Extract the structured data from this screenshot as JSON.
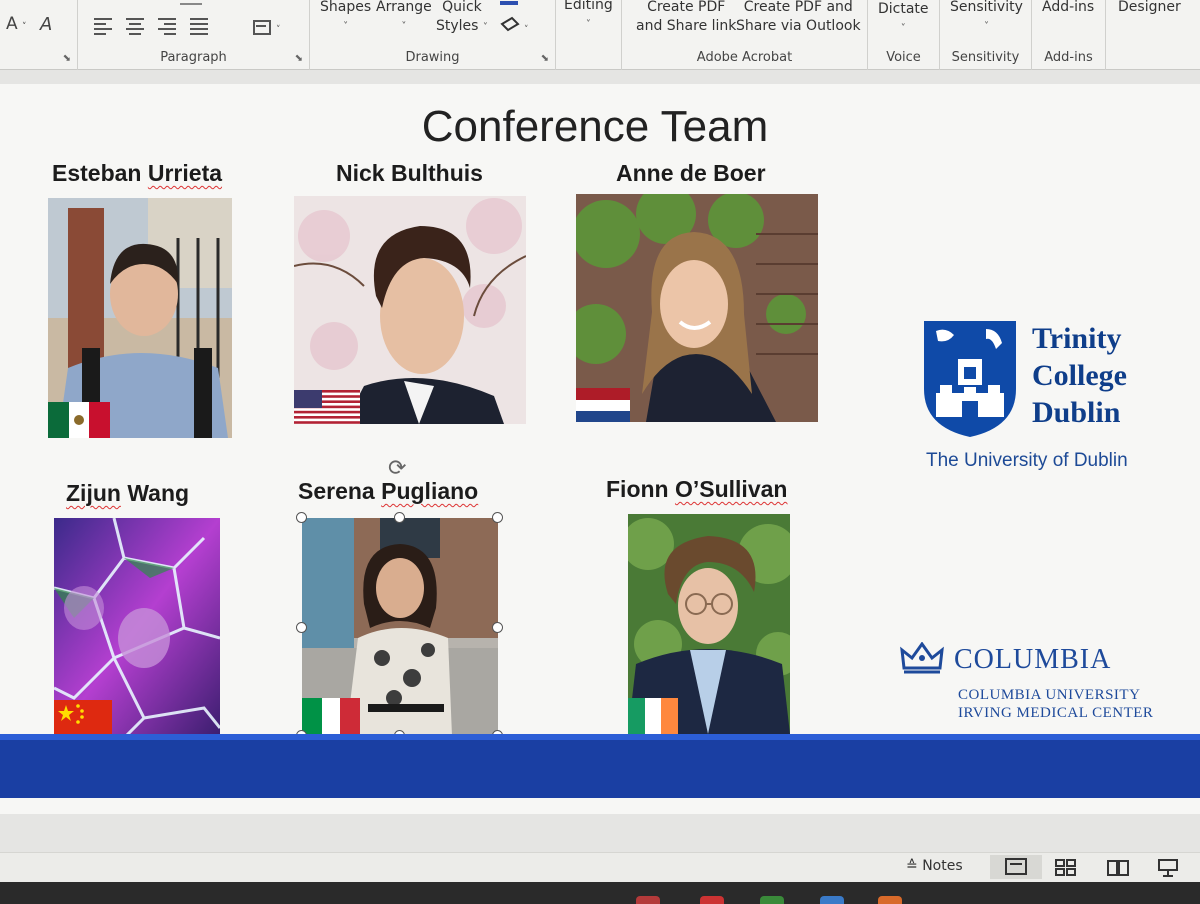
{
  "ribbon": {
    "font_group": {
      "grow_icon": "A",
      "style_icon": "A"
    },
    "paragraph": {
      "label": "Paragraph"
    },
    "drawing": {
      "label": "Drawing",
      "shapes": "Shapes",
      "arrange": "Arrange",
      "quick_styles_line1": "Quick",
      "quick_styles_line2": "Styles"
    },
    "editing": {
      "label": "Editing"
    },
    "acrobat": {
      "label": "Adobe Acrobat",
      "create_pdf_line1": "Create PDF",
      "create_pdf_line2": "and Share link",
      "outlook_line1": "Create PDF and",
      "outlook_line2": "Share via Outlook"
    },
    "voice": {
      "label": "Voice",
      "dictate": "Dictate"
    },
    "sensitivity": {
      "label": "Sensitivity",
      "button": "Sensitivity"
    },
    "addins": {
      "label": "Add-ins",
      "button": "Add-ins"
    },
    "designer": {
      "button": "Designer"
    }
  },
  "slide": {
    "title": "Conference Team",
    "members": [
      {
        "name_first": "Esteban ",
        "name_last": "Urrieta",
        "flag": "mexico-flag"
      },
      {
        "name": "Nick Bulthuis",
        "flag": "usa-flag"
      },
      {
        "name": "Anne de Boer",
        "flag": "netherlands-flag"
      },
      {
        "name_first": "Zijun",
        "name_last": " Wang",
        "flag": "china-flag"
      },
      {
        "name_first": "Serena ",
        "name_last": "Pugliano",
        "flag": "italy-flag"
      },
      {
        "name_first": "Fionn ",
        "name_last": "O’Sullivan",
        "flag": "ireland-flag"
      }
    ],
    "tcd": {
      "line1": "Trinity",
      "line2": "College",
      "line3": "Dublin",
      "subtitle": "The University of Dublin"
    },
    "columbia": {
      "word": "COLUMBIA",
      "sub1": "COLUMBIA UNIVERSITY",
      "sub2": "IRVING MEDICAL CENTER"
    }
  },
  "statusbar": {
    "notes": "Notes"
  },
  "colors": {
    "accent_blue": "#1a3fa3",
    "tcd_blue": "#0f3e8a",
    "columbia_blue": "#1e4a9b"
  }
}
